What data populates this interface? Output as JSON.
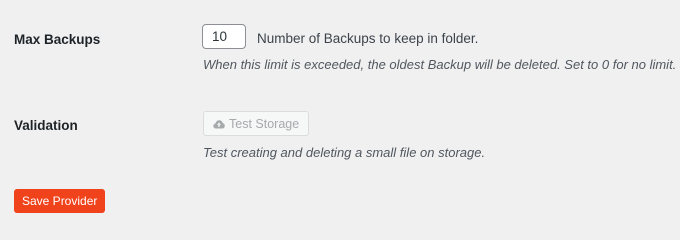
{
  "max_backups": {
    "label": "Max Backups",
    "value": "10",
    "inline_description": "Number of Backups to keep in folder.",
    "description": "When this limit is exceeded, the oldest Backup will be deleted. Set to 0 for no limit."
  },
  "validation": {
    "label": "Validation",
    "button_label": "Test Storage",
    "button_icon": "cloud-upload-icon",
    "description": "Test creating and deleting a small file on storage."
  },
  "save_button": {
    "label": "Save Provider",
    "color": "#f0421b"
  }
}
